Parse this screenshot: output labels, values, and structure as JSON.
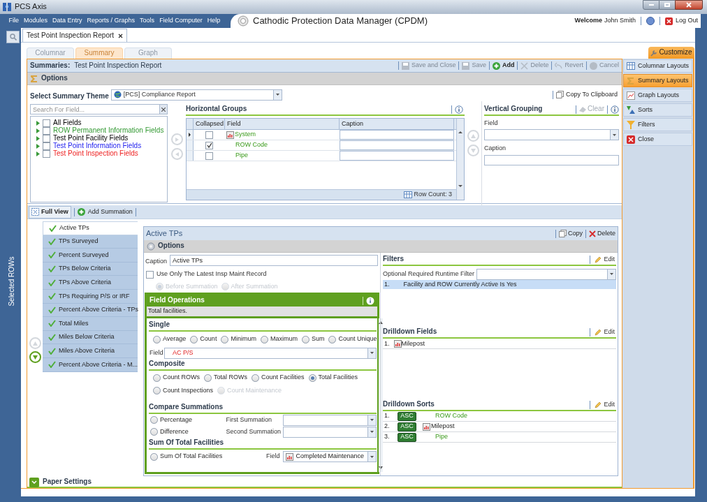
{
  "window": {
    "title": "PCS Axis"
  },
  "menu": [
    "File",
    "Modules",
    "Data Entry",
    "Reports / Graphs",
    "Tools",
    "Field Computer",
    "Help"
  ],
  "app_title": "Cathodic Protection Data Manager (CPDM)",
  "user": {
    "welcome": "Welcome",
    "name": "John Smith",
    "logout": "Log Out"
  },
  "side_strip": {
    "label": "Selected ROWs"
  },
  "doc_tabs": [
    {
      "label": "Test Point Inspection Report",
      "selected": true
    }
  ],
  "view_tabs": [
    {
      "label": "Columnar",
      "selected": false
    },
    {
      "label": "Summary",
      "selected": true
    },
    {
      "label": "Graph",
      "selected": false
    }
  ],
  "customize": {
    "label": "Customize",
    "items": [
      {
        "label": "Columnar Layouts",
        "kind": "columnar",
        "selected": false
      },
      {
        "label": "Summary Layouts",
        "kind": "summary",
        "selected": true
      },
      {
        "label": "Graph Layouts",
        "kind": "graph",
        "selected": false
      },
      {
        "label": "Sorts",
        "kind": "sorts",
        "selected": false
      },
      {
        "label": "Filters",
        "kind": "filters",
        "selected": false
      },
      {
        "label": "Close",
        "kind": "close",
        "selected": false
      }
    ]
  },
  "summaries": {
    "label": "Summaries:",
    "name": "Test Point Inspection Report",
    "toolbar": [
      {
        "label": "Save and Close",
        "kind": "save_close",
        "disabled": true
      },
      {
        "label": "Save",
        "kind": "save",
        "disabled": true
      },
      {
        "label": "Add",
        "kind": "add",
        "disabled": false
      },
      {
        "label": "Delete",
        "kind": "delete",
        "disabled": true
      },
      {
        "label": "Revert",
        "kind": "revert",
        "disabled": true
      },
      {
        "label": "Cancel",
        "kind": "cancel",
        "disabled": true
      }
    ]
  },
  "options": {
    "title": "Options",
    "theme_label": "Select Summary Theme",
    "theme": "[PCS] Compliance Report",
    "copy": "Copy To Clipboard",
    "search_placeholder": "Search For Field...",
    "field_tree": [
      {
        "label": "All Fields",
        "color": "#000000",
        "checked": false
      },
      {
        "label": "ROW Permanent Information Fields",
        "color": "#339933",
        "checked": false
      },
      {
        "label": "Test Point Facility Fields",
        "color": "#000000",
        "checked": false
      },
      {
        "label": "Test Point Information Fields",
        "color": "#2222ee",
        "checked": false
      },
      {
        "label": "Test Point Inspection Fields",
        "color": "#ee2222",
        "checked": false
      }
    ]
  },
  "horizontal_groups": {
    "title": "Horizontal Groups",
    "columns": [
      "Collapsed",
      "Field",
      "Caption"
    ],
    "rows": [
      {
        "field": "System",
        "kind": "calculated",
        "collapsed": false,
        "selected": true
      },
      {
        "field": "ROW Code",
        "kind": "field",
        "collapsed": true,
        "selected": false
      },
      {
        "field": "Pipe",
        "kind": "field",
        "collapsed": false,
        "selected": false
      }
    ],
    "row_count": "Row Count:  3"
  },
  "vertical_grouping": {
    "title": "Vertical Grouping",
    "clear": "Clear",
    "field_label": "Field",
    "caption_label": "Caption"
  },
  "summation_toolbar": {
    "full_view": "Full View",
    "add": "Add Summation"
  },
  "summations": [
    {
      "label": "Active TPs",
      "selected": true
    },
    {
      "label": "TPs Surveyed",
      "selected": false
    },
    {
      "label": "Percent Surveyed",
      "selected": false
    },
    {
      "label": "TPs Below Criteria",
      "selected": false
    },
    {
      "label": "TPs Above Criteria",
      "selected": false
    },
    {
      "label": "TPs Requiring P/S or IRF",
      "selected": false
    },
    {
      "label": "Percent Above Criteria - TPs",
      "selected": false
    },
    {
      "label": "Total Miles",
      "selected": false
    },
    {
      "label": "Miles Below Criteria",
      "selected": false
    },
    {
      "label": "Miles Above Criteria",
      "selected": false
    },
    {
      "label": "Percent Above Criteria - M...",
      "selected": false
    }
  ],
  "detail": {
    "title": "Active TPs",
    "copy": "Copy",
    "delete": "Delete",
    "options": "Options",
    "caption_label": "Caption",
    "caption": "Active TPs",
    "latest_only": {
      "label": "Use Only The Latest Insp Maint Record",
      "checked": false
    },
    "timing": [
      {
        "label": "Before Summation",
        "selected": true,
        "disabled": true
      },
      {
        "label": "After Summation",
        "selected": false,
        "disabled": true
      }
    ],
    "field_operations": {
      "title": "Field Operations",
      "description": "Total facilities.",
      "single": {
        "title": "Single",
        "options": [
          {
            "label": "Average",
            "selected": false
          },
          {
            "label": "Count",
            "selected": false
          },
          {
            "label": "Minimum",
            "selected": false
          },
          {
            "label": "Maximum",
            "selected": false
          },
          {
            "label": "Sum",
            "selected": false
          },
          {
            "label": "Count Unique",
            "selected": false
          }
        ],
        "field_label": "Field",
        "field": "AC P/S"
      },
      "composite": {
        "title": "Composite",
        "options": [
          {
            "label": "Count ROWs",
            "selected": false,
            "disabled": false
          },
          {
            "label": "Total ROWs",
            "selected": false,
            "disabled": false
          },
          {
            "label": "Count Facilities",
            "selected": false,
            "disabled": false
          },
          {
            "label": "Total Facilities",
            "selected": true,
            "disabled": false
          },
          {
            "label": "Count Inspections",
            "selected": false,
            "disabled": false
          },
          {
            "label": "Count Maintenance",
            "selected": false,
            "disabled": true
          }
        ]
      },
      "compare": {
        "title": "Compare Summations",
        "options": [
          {
            "label": "Percentage",
            "selected": false
          },
          {
            "label": "Difference",
            "selected": false
          }
        ],
        "first_label": "First Summation",
        "second_label": "Second Summation"
      },
      "sum_total": {
        "title": "Sum Of Total Facilities",
        "option": {
          "label": "Sum Of Total Facilities",
          "selected": false
        },
        "field_label": "Field",
        "field": "Completed Maintenance"
      }
    }
  },
  "filters": {
    "title": "Filters",
    "edit": "Edit",
    "runtime_label": "Optional Required Runtime Filter",
    "items": [
      {
        "index": "1.",
        "text": "Facility and ROW Currently Active Is Yes"
      }
    ]
  },
  "drilldown_fields": {
    "title": "Drilldown Fields",
    "edit": "Edit",
    "items": [
      {
        "index": "1.",
        "text": "Milepost",
        "kind": "calculated"
      }
    ]
  },
  "drilldown_sorts": {
    "title": "Drilldown Sorts",
    "edit": "Edit",
    "items": [
      {
        "index": "1.",
        "order": "ASC",
        "field": "ROW Code",
        "kind": "field"
      },
      {
        "index": "2.",
        "order": "ASC",
        "field": "Milepost",
        "kind": "calculated"
      },
      {
        "index": "3.",
        "order": "ASC",
        "field": "Pipe",
        "kind": "field"
      }
    ]
  },
  "paper_settings": {
    "label": "Paper Settings",
    "expanded": false
  }
}
